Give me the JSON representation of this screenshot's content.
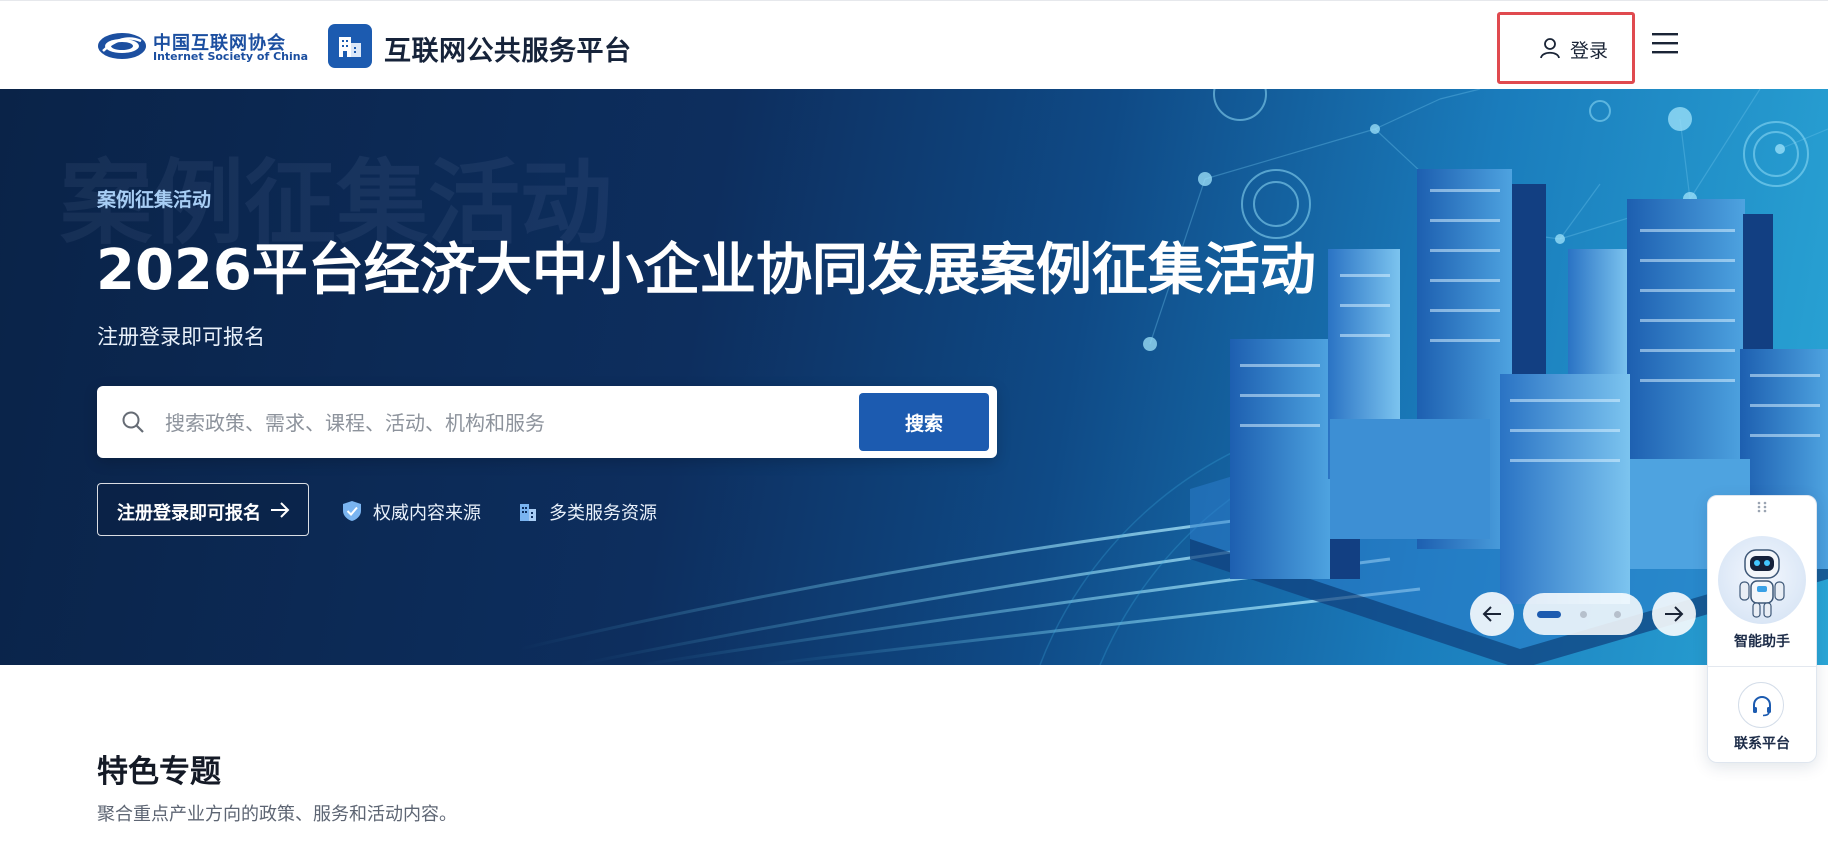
{
  "header": {
    "org_logo_cn": "中国互联网协会",
    "org_logo_en": "Internet Society of China",
    "platform_name": "互联网公共服务平台",
    "login_label": "登录"
  },
  "hero": {
    "kicker": "案例征集活动",
    "title": "2026平台经济大中小企业协同发展案例征集活动",
    "subtitle": "注册登录即可报名",
    "search": {
      "placeholder": "搜索政策、需求、课程、活动、机构和服务",
      "value": "",
      "button_label": "搜索"
    },
    "register_button": "注册登录即可报名",
    "features": [
      "权威内容来源",
      "多类服务资源"
    ],
    "carousel": {
      "slides": 3,
      "active": 1
    }
  },
  "assistant": {
    "ai_label": "智能助手",
    "contact_label": "联系平台"
  },
  "section": {
    "title": "特色专题",
    "subtitle": "聚合重点产业方向的政策、服务和活动内容。"
  },
  "colors": {
    "brand": "#1c5bb0",
    "hero_dark": "#0a2348",
    "hero_light": "#2aa6d6",
    "highlight_border": "#e04a4f"
  },
  "icons": [
    "isc-logo",
    "platform-building-icon",
    "user-icon",
    "menu-icon",
    "search-icon",
    "arrow-right-icon",
    "shield-check-icon",
    "building-icon",
    "arrow-left-icon",
    "drag-handle-icon",
    "robot-avatar",
    "headset-icon"
  ]
}
